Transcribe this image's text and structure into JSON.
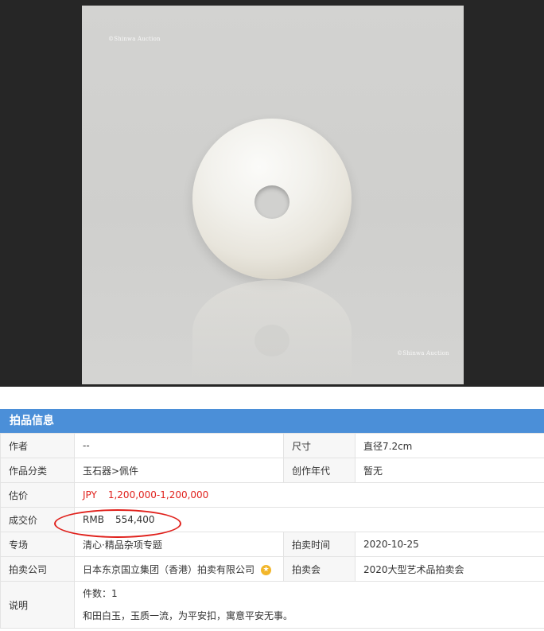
{
  "image": {
    "watermark_top": "©Shinwa Auction",
    "watermark_bottom": "©Shinwa Auction"
  },
  "panel": {
    "header": "拍品信息",
    "rows": {
      "author": {
        "label": "作者",
        "value": "--"
      },
      "size": {
        "label": "尺寸",
        "value": "直径7.2cm"
      },
      "category": {
        "label": "作品分类",
        "value": "玉石器>佩件"
      },
      "year": {
        "label": "创作年代",
        "value": "暂无"
      },
      "estimate": {
        "label": "估价",
        "currency": "JPY",
        "value": "1,200,000-1,200,000"
      },
      "deal": {
        "label": "成交价",
        "currency": "RMB",
        "value": "554,400"
      },
      "session": {
        "label": "专场",
        "value": "清心·精品杂项专题"
      },
      "auction_time": {
        "label": "拍卖时间",
        "value": "2020-10-25"
      },
      "company": {
        "label": "拍卖公司",
        "value": "日本东京国立集团（香港）拍卖有限公司"
      },
      "sale": {
        "label": "拍卖会",
        "value": "2020大型艺术品拍卖会"
      },
      "note": {
        "label": "说明",
        "line1": "件数：1",
        "line2": "和田白玉，玉质一流，为平安扣，寓意平安无事。"
      }
    }
  },
  "colors": {
    "header_bg": "#4b8fd8",
    "price_red": "#e0211c",
    "highlight_oval": "#e0211c"
  }
}
